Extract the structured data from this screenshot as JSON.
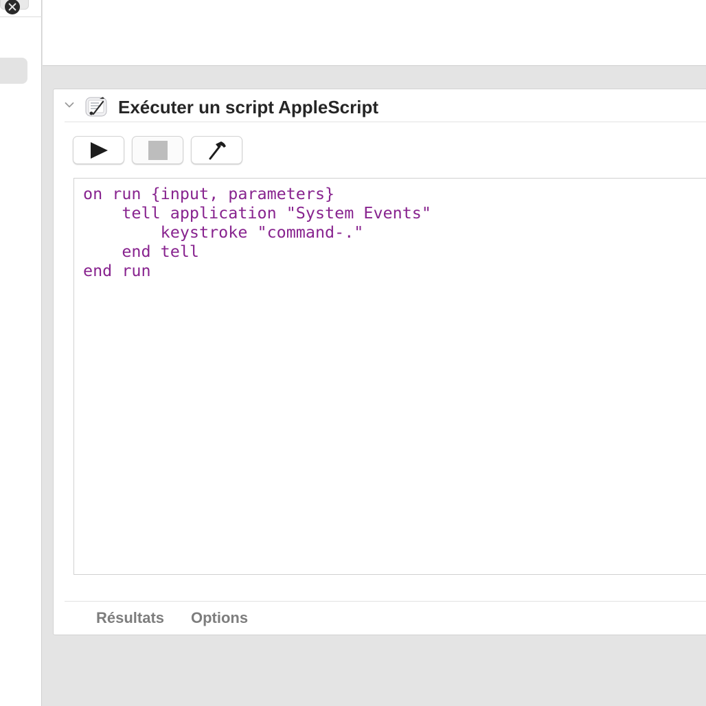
{
  "action": {
    "title": "Exécuter un script AppleScript",
    "icon": "script-editor-icon"
  },
  "toolbar": {
    "run_icon": "play-icon",
    "stop_icon": "stop-icon",
    "compile_icon": "hammer-icon"
  },
  "editor": {
    "code_lines": [
      "on run {input, parameters}",
      "    tell application \"System Events\"",
      "        keystroke \"command-.\"",
      "    end tell",
      "end run"
    ],
    "code_color": "#88248f"
  },
  "footer": {
    "tabs": [
      {
        "label": "Résultats"
      },
      {
        "label": "Options"
      }
    ]
  }
}
